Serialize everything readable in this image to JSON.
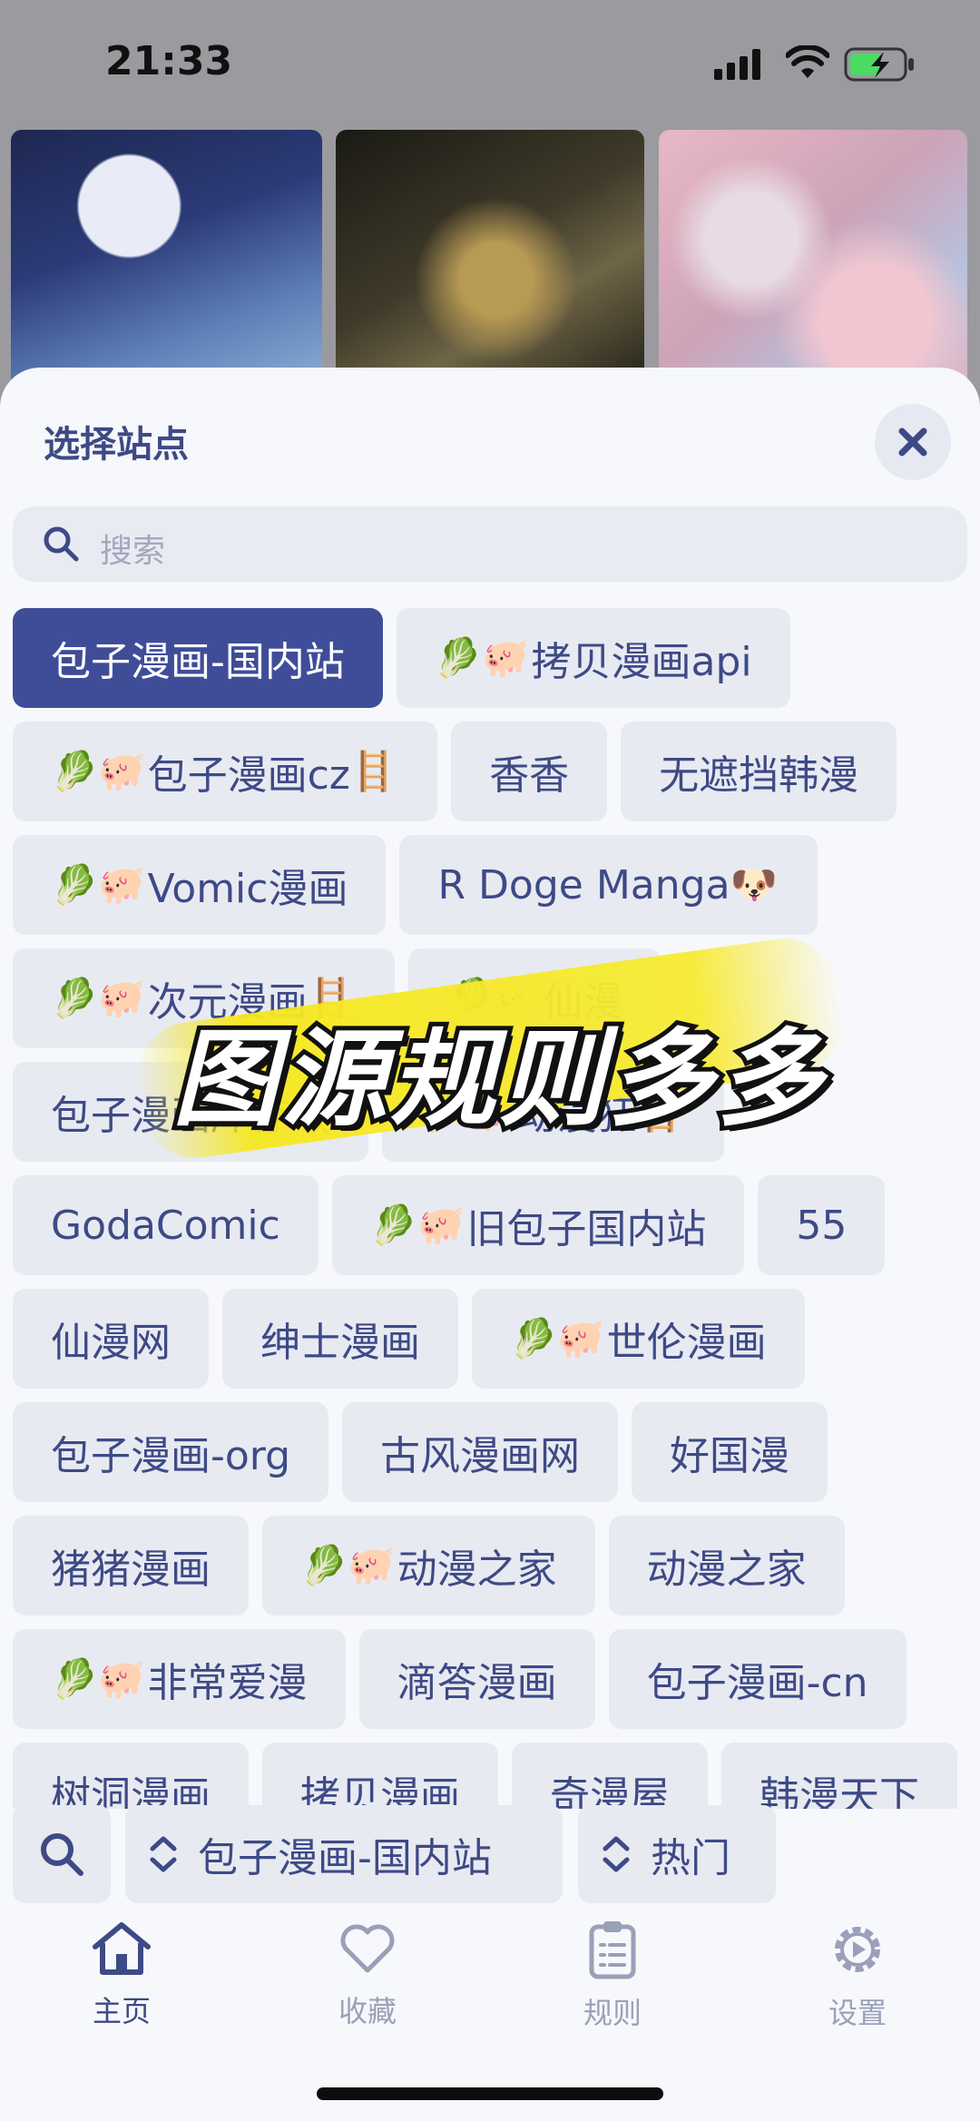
{
  "status_bar": {
    "time": "21:33"
  },
  "sheet": {
    "title": "选择站点"
  },
  "search": {
    "placeholder": "搜索"
  },
  "site_rows": [
    [
      {
        "label": "包子漫画-国内站",
        "selected": true
      },
      {
        "label": "拷贝漫画api",
        "prefix": "🥬🐖"
      }
    ],
    [
      {
        "label": "包子漫画cz",
        "prefix": "🥬🐖",
        "suffix": "🪜"
      },
      {
        "label": "香香"
      },
      {
        "label": "无遮挡韩漫"
      }
    ],
    [
      {
        "label": "Vomic漫画",
        "prefix": "🥬🐖"
      },
      {
        "label": "R Doge Manga",
        "suffix": "🐶"
      }
    ],
    [
      {
        "label": "次元漫画",
        "prefix": "🥬🐖",
        "suffix": "🪜"
      },
      {
        "label": "仙漫",
        "prefix": "🥬🐖"
      }
    ],
    [
      {
        "label": "包子漫画库存版"
      },
      {
        "label": "动漫狂",
        "prefix": "🥬🐖",
        "suffix": "🪜"
      }
    ],
    [
      {
        "label": "GodaComic"
      },
      {
        "label": "旧包子国内站",
        "prefix": "🥬🐖"
      },
      {
        "label": "55"
      }
    ],
    [
      {
        "label": "仙漫网"
      },
      {
        "label": "绅士漫画"
      },
      {
        "label": "世伦漫画",
        "prefix": "🥬🐖"
      }
    ],
    [
      {
        "label": "包子漫画-org"
      },
      {
        "label": "古风漫画网"
      },
      {
        "label": "好国漫"
      }
    ],
    [
      {
        "label": "猪猪漫画"
      },
      {
        "label": "动漫之家",
        "prefix": "🥬🐖"
      },
      {
        "label": "动漫之家"
      }
    ],
    [
      {
        "label": "非常爱漫",
        "prefix": "🥬🐖"
      },
      {
        "label": "滴答漫画"
      },
      {
        "label": "包子漫画-cn"
      }
    ],
    [
      {
        "label": "树洞漫画"
      },
      {
        "label": "拷贝漫画"
      },
      {
        "label": "奇漫屋"
      },
      {
        "label": "韩漫天下"
      }
    ]
  ],
  "overlay_caption": "图源规则多多",
  "bottom_bar": {
    "site_select": "包子漫画-国内站",
    "sort_select": "热门"
  },
  "tabs": [
    {
      "label": "主页",
      "icon": "home-icon",
      "active": true
    },
    {
      "label": "收藏",
      "icon": "heart-icon",
      "active": false
    },
    {
      "label": "规则",
      "icon": "clipboard-icon",
      "active": false
    },
    {
      "label": "设置",
      "icon": "gear-icon",
      "active": false
    }
  ],
  "colors": {
    "accent": "#3f4d99",
    "chip_bg": "#e8eaf1",
    "chip_text": "#3d4a86",
    "inactive_tab": "#9aa0b8"
  }
}
